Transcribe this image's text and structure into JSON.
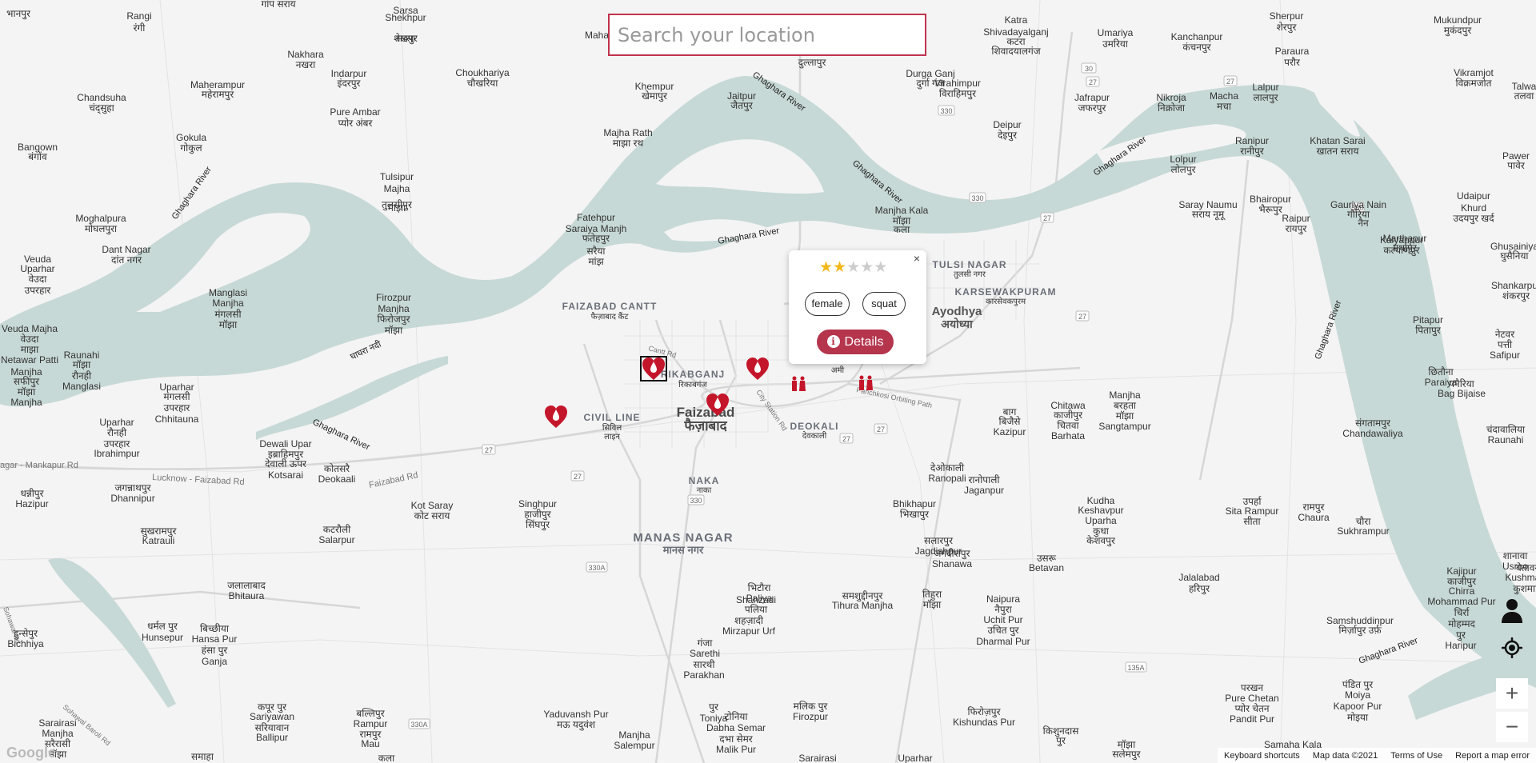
{
  "search": {
    "placeholder": "Search your location",
    "value": ""
  },
  "popup": {
    "rating": 2,
    "max_rating": 5,
    "stars": [
      "★",
      "★",
      "★",
      "★",
      "★"
    ],
    "tags": [
      "female",
      "squat"
    ],
    "details_label": "Details",
    "close_label": "×",
    "info_glyph": "i"
  },
  "places": [
    {
      "t": "भानपुर"
    },
    {
      "t": "Rangi"
    },
    {
      "t": "रंगी"
    },
    {
      "t": "गांप सराय"
    },
    {
      "t": "Sarsa"
    },
    {
      "t": "Shekhpur"
    },
    {
      "t": "सरसा"
    },
    {
      "t": "शेखपुर"
    },
    {
      "t": "Maha"
    },
    {
      "t": "दुल्लापुर"
    },
    {
      "t": "Katra"
    },
    {
      "t": "Shivadayalganj"
    },
    {
      "t": "कटरा"
    },
    {
      "t": "शिवादयालगंज"
    },
    {
      "t": "Umariya"
    },
    {
      "t": "उमरिया"
    },
    {
      "t": "Kanchanpur"
    },
    {
      "t": "कंचनपुर"
    },
    {
      "t": "Sherpur"
    },
    {
      "t": "शेरपुर"
    },
    {
      "t": "Mukundpur"
    },
    {
      "t": "मुकंदपुर"
    },
    {
      "t": "Nakhara"
    },
    {
      "t": "नखरा"
    },
    {
      "t": "Paraura"
    },
    {
      "t": "परौर"
    },
    {
      "t": "Maherampur"
    },
    {
      "t": "महेरामपुर"
    },
    {
      "t": "Indarpur"
    },
    {
      "t": "इंदरपुर"
    },
    {
      "t": "Choukhariya"
    },
    {
      "t": "चौखरिया"
    },
    {
      "t": "Khempur"
    },
    {
      "t": "खेमापुर"
    },
    {
      "t": "Jaitpur"
    },
    {
      "t": "जैतपुर"
    },
    {
      "t": "Durga Ganj"
    },
    {
      "t": "दुर्गा गंज"
    },
    {
      "t": "Virahimpur"
    },
    {
      "t": "विराहिमपुर"
    },
    {
      "t": "Jafrapur"
    },
    {
      "t": "जफरपुर"
    },
    {
      "t": "Nikroja"
    },
    {
      "t": "निक्रोजा"
    },
    {
      "t": "Macha"
    },
    {
      "t": "मचा"
    },
    {
      "t": "Lalpur"
    },
    {
      "t": "लालपुर"
    },
    {
      "t": "Vikramjot"
    },
    {
      "t": "विक्रमजोत"
    },
    {
      "t": "Talwa"
    },
    {
      "t": "तलवा"
    },
    {
      "t": "Chandsuha"
    },
    {
      "t": "चंद्सुहा"
    },
    {
      "t": "Pure Ambar"
    },
    {
      "t": "प्योर अंबर"
    },
    {
      "t": "Gokula"
    },
    {
      "t": "गोकुल"
    },
    {
      "t": "Majha Rath"
    },
    {
      "t": "माझा रथ"
    },
    {
      "t": "Deipur"
    },
    {
      "t": "देइपुर"
    },
    {
      "t": "Ranipur"
    },
    {
      "t": "रानीपुर"
    },
    {
      "t": "Khatan Sarai"
    },
    {
      "t": "खातन सराय"
    },
    {
      "t": "Pawer"
    },
    {
      "t": "पावेर"
    },
    {
      "t": "Bangown"
    },
    {
      "t": "बंगोंव"
    },
    {
      "t": "Lolpur"
    },
    {
      "t": "लोलपुर"
    },
    {
      "t": "Tulsipur"
    },
    {
      "t": "Majha"
    },
    {
      "t": "तुलसीपुर"
    },
    {
      "t": "माझा"
    },
    {
      "t": "Bhairopur"
    },
    {
      "t": "भैरूपुर"
    },
    {
      "t": "Gauriya Nain"
    },
    {
      "t": "गौरिया"
    },
    {
      "t": "नैन"
    },
    {
      "t": "Udaipur"
    },
    {
      "t": "Khurd"
    },
    {
      "t": "उदयपुर खर्द"
    },
    {
      "t": "Saray Naumu"
    },
    {
      "t": "सराय नूमू"
    },
    {
      "t": "Moghalpura"
    },
    {
      "t": "मोघलपुरा"
    },
    {
      "t": "Fatehpur"
    },
    {
      "t": "Saraiya Manjh"
    },
    {
      "t": "फतेहपुर"
    },
    {
      "t": "सरैया"
    },
    {
      "t": "मांझ"
    },
    {
      "t": "Manjha Kala"
    },
    {
      "t": "मॉझा"
    },
    {
      "t": "कला"
    },
    {
      "t": "Raipur"
    },
    {
      "t": "रायपुर"
    },
    {
      "t": "Marthapur"
    },
    {
      "t": "मर्थापुर"
    },
    {
      "t": "Dant Nagar"
    },
    {
      "t": "दांत नगर"
    },
    {
      "t": "Ghusainiya"
    },
    {
      "t": "घुसैनिया"
    },
    {
      "t": "Veuda"
    },
    {
      "t": "Uparhar"
    },
    {
      "t": "वेउदा"
    },
    {
      "t": "उपरहार"
    },
    {
      "t": "Kalyanpur"
    },
    {
      "t": "कल्याणपुर"
    },
    {
      "t": "Shankarpur"
    },
    {
      "t": "शंकरपुर"
    },
    {
      "t": "Manglasi"
    },
    {
      "t": "Manjha"
    },
    {
      "t": "मंगलसी"
    },
    {
      "t": "मॉझा"
    },
    {
      "t": "Firozpur"
    },
    {
      "t": "Manjha"
    },
    {
      "t": "फिरोजपुर"
    },
    {
      "t": "मॉझा"
    },
    {
      "t": "Pitapur"
    },
    {
      "t": "पितापुर"
    },
    {
      "t": "Veuda Majha"
    },
    {
      "t": "वेउदा"
    },
    {
      "t": "माझा"
    },
    {
      "t": "Netawar Patti"
    },
    {
      "t": "नेटवर"
    },
    {
      "t": "पत्ती"
    },
    {
      "t": "Safipur"
    },
    {
      "t": "Manjha"
    },
    {
      "t": "सफीपुर"
    },
    {
      "t": "मॉझा"
    },
    {
      "t": "Manjha"
    },
    {
      "t": "Raunahi"
    },
    {
      "t": "मॉझा"
    },
    {
      "t": "रौनही"
    },
    {
      "t": "Manglasi"
    },
    {
      "t": "Uparhar"
    },
    {
      "t": "मंगलसी"
    },
    {
      "t": "उपरहार"
    },
    {
      "t": "Chhitauna"
    },
    {
      "t": "छितौना"
    },
    {
      "t": "Paraiya"
    },
    {
      "t": "पनैरिया"
    },
    {
      "t": "Bag Bijaise"
    },
    {
      "t": "बाग"
    },
    {
      "t": "बिजैसे"
    },
    {
      "t": "Kazipur"
    },
    {
      "t": "Chitawa"
    },
    {
      "t": "काजीपुर"
    },
    {
      "t": "चितवा"
    },
    {
      "t": "Barhata"
    },
    {
      "t": "Manjha"
    },
    {
      "t": "बरहता"
    },
    {
      "t": "मॉझा"
    },
    {
      "t": "Sangtampur"
    },
    {
      "t": "संगतामपुर"
    },
    {
      "t": "Chandawaliya"
    },
    {
      "t": "चंदावालिया"
    },
    {
      "t": "Raunahi"
    },
    {
      "t": "Uparhar"
    },
    {
      "t": "रौनही"
    },
    {
      "t": "उपरहार"
    },
    {
      "t": "Ibrahimpur"
    },
    {
      "t": "Dewali Upar"
    },
    {
      "t": "इब्राहिमपुर"
    },
    {
      "t": "देवाली ऊपर"
    },
    {
      "t": "Kotsarai"
    },
    {
      "t": "कोतसरै"
    },
    {
      "t": "Deokaali"
    },
    {
      "t": "देओकाली"
    },
    {
      "t": "Ranopali"
    },
    {
      "t": "रानोपाली"
    },
    {
      "t": "Jaganpur"
    },
    {
      "t": "जगन्नाथपुर"
    },
    {
      "t": "Dhannipur"
    },
    {
      "t": "धन्नीपुर"
    },
    {
      "t": "Hazipur"
    },
    {
      "t": "Singhpur"
    },
    {
      "t": "हाजीपुर"
    },
    {
      "t": "सिंघपुर"
    },
    {
      "t": "Kot Saray"
    },
    {
      "t": "कोट सराय"
    },
    {
      "t": "Bhikhapur"
    },
    {
      "t": "भिखापुर"
    },
    {
      "t": "Kudha"
    },
    {
      "t": "Keshavpur"
    },
    {
      "t": "Uparha"
    },
    {
      "t": "कुधा"
    },
    {
      "t": "केशवपुर"
    },
    {
      "t": "उपर्हा"
    },
    {
      "t": "Sita Rampur"
    },
    {
      "t": "सीता"
    },
    {
      "t": "रामपुर"
    },
    {
      "t": "Chaura"
    },
    {
      "t": "चौरा"
    },
    {
      "t": "Sukhrampur"
    },
    {
      "t": "सुखरामपुर"
    },
    {
      "t": "Katrauli"
    },
    {
      "t": "कटरौली"
    },
    {
      "t": "Salarpur"
    },
    {
      "t": "सलारपुर"
    },
    {
      "t": "Jagdishpur"
    },
    {
      "t": "जगदीशपुर"
    },
    {
      "t": "Shanawa"
    },
    {
      "t": "शानावा"
    },
    {
      "t": "Usroo"
    },
    {
      "t": "उसरू"
    },
    {
      "t": "Betavan"
    },
    {
      "t": "बेतावन"
    },
    {
      "t": "Kushmaha"
    },
    {
      "t": "कुशमाहा"
    },
    {
      "t": "Kajipur"
    },
    {
      "t": "काजीपुर"
    },
    {
      "t": "Chirra"
    },
    {
      "t": "Mohammad Pur"
    },
    {
      "t": "चिर्रा"
    },
    {
      "t": "मोहम्मद"
    },
    {
      "t": "पुर"
    },
    {
      "t": "Haripur"
    },
    {
      "t": "Jalalabad"
    },
    {
      "t": "हरिपुर"
    },
    {
      "t": "जलालाबाद"
    },
    {
      "t": "Bhitaura"
    },
    {
      "t": "भिटौरा"
    },
    {
      "t": "Paliya"
    },
    {
      "t": "Shahzadi"
    },
    {
      "t": "पलिया"
    },
    {
      "t": "शहज़ादी"
    },
    {
      "t": "Mirzapur Urf"
    },
    {
      "t": "Samshuddinpur"
    },
    {
      "t": "मिर्ज़ापुर उर्फ़"
    },
    {
      "t": "समशुद्दीनपुर"
    },
    {
      "t": "Tihura Manjha"
    },
    {
      "t": "तिहुरा"
    },
    {
      "t": "मॉझा"
    },
    {
      "t": "Naipura"
    },
    {
      "t": "नैपुरा"
    },
    {
      "t": "Uchit Pur"
    },
    {
      "t": "उचित पुर"
    },
    {
      "t": "Dharmal Pur"
    },
    {
      "t": "धर्मल पुर"
    },
    {
      "t": "Hunsepur"
    },
    {
      "t": "हुन्सेपुर"
    },
    {
      "t": "Bichhiya"
    },
    {
      "t": "बिच्छीया"
    },
    {
      "t": "Hansa Pur"
    },
    {
      "t": "हंसा पुर"
    },
    {
      "t": "Ganja"
    },
    {
      "t": "गंजा"
    },
    {
      "t": "Sarethi"
    },
    {
      "t": "सारथी"
    },
    {
      "t": "Parakhan"
    },
    {
      "t": "परखन"
    },
    {
      "t": "Pure Chetan"
    },
    {
      "t": "प्योर चेतन"
    },
    {
      "t": "Pandit Pur"
    },
    {
      "t": "पंडित पुर"
    },
    {
      "t": "Moiya"
    },
    {
      "t": "Kapoor Pur"
    },
    {
      "t": "मोइया"
    },
    {
      "t": "कपूर पुर"
    },
    {
      "t": "Sariyawan"
    },
    {
      "t": "सरियावान"
    },
    {
      "t": "Ballipur"
    },
    {
      "t": "बल्लिपुर"
    },
    {
      "t": "Rampur"
    },
    {
      "t": "रामपुर"
    },
    {
      "t": "Mau"
    },
    {
      "t": "Yaduvansh Pur"
    },
    {
      "t": "मऊ यदुवंश"
    },
    {
      "t": "पुर"
    },
    {
      "t": "Toniya"
    },
    {
      "t": "टोनिया"
    },
    {
      "t": "Dabha Semar"
    },
    {
      "t": "दभा सेमर"
    },
    {
      "t": "Malik Pur"
    },
    {
      "t": "मलिक पुर"
    },
    {
      "t": "Firozpur"
    },
    {
      "t": "फिरोज़पुर"
    },
    {
      "t": "Kishundas Pur"
    },
    {
      "t": "किशुनदास"
    },
    {
      "t": "पुर"
    },
    {
      "t": "Sarairasi"
    },
    {
      "t": "Manjha"
    },
    {
      "t": "सरैरासी"
    },
    {
      "t": "मॉझा"
    },
    {
      "t": "Manjha"
    },
    {
      "t": "Salempur"
    },
    {
      "t": "मॉझा"
    },
    {
      "t": "सलेमपुर"
    },
    {
      "t": "Samaha Kala"
    },
    {
      "t": "समाहा"
    },
    {
      "t": "कला"
    },
    {
      "t": "Sarairasi"
    },
    {
      "t": "Uparhar"
    },
    {
      "t": "सरैरासी"
    },
    {
      "t": "उपरहार"
    },
    {
      "t": "Manjhapure"
    },
    {
      "t": "Chetan"
    },
    {
      "t": "मंझापुरे"
    },
    {
      "t": "चेतन"
    },
    {
      "t": "Sirhirnar"
    },
    {
      "t": "Singhpur"
    },
    {
      "t": "सिर्हिनर"
    },
    {
      "t": "सिंघपुर"
    },
    {
      "t": "Gauhaniya"
    },
    {
      "t": "Saloni"
    },
    {
      "t": "गौहानिया"
    },
    {
      "t": "सलोनी"
    },
    {
      "t": "Kurawan"
    },
    {
      "t": "कुरवान"
    },
    {
      "t": "Ragghoopur"
    },
    {
      "t": "रागघूपुर"
    },
    {
      "t": "Khanpur"
    },
    {
      "t": "Masodha"
    },
    {
      "t": "खानपुर"
    },
    {
      "t": "मसोधा"
    },
    {
      "t": "Bhadokhar"
    },
    {
      "t": "भादोखार"
    },
    {
      "t": "Dadera"
    },
    {
      "t": "दादेरा"
    },
    {
      "t": "Bahoran Pur"
    },
    {
      "t": "बाहोरन पुर"
    },
    {
      "t": "Gaura"
    },
    {
      "t": "Brahman"
    },
    {
      "t": "गौरा"
    },
    {
      "t": "ब्राह्मण"
    },
    {
      "t": "Mahawan"
    },
    {
      "t": "महावान"
    },
    {
      "t": "Baisingh"
    },
    {
      "t": "बैसिंघ"
    },
    {
      "t": "Rajepur"
    },
    {
      "t": "Mohjuddin Pur"
    },
    {
      "t": "Sathri"
    },
    {
      "t": "Birauli"
    },
    {
      "t": "Uchar Pur"
    }
  ],
  "major_places": {
    "faizabad_cantt": "FAIZABAD CANTT",
    "faizabad_cantt_hi": "फैज़ाबाद कैंट",
    "rikabganj": "RIKABGANJ",
    "rikabganj_hi": "रिकाबगंज",
    "civil_line": "CIVIL LINE",
    "civil_line_hi": "सिविल",
    "civil_line_hi2": "लाइन",
    "faizabad": "Faizabad",
    "faizabad_hi": "फैज़ाबाद",
    "deokali": "DEOKALI",
    "deokali_hi": "देवकाली",
    "naka": "NAKA",
    "naka_hi": "नाका",
    "manas_nagar": "MANAS NAGAR",
    "manas_nagar_hi": "मानस नगर",
    "ayodhya": "Ayodhya",
    "ayodhya_hi": "अयोध्या",
    "tulsi_nagar": "TULSI NAGAR",
    "tulsi_nagar_hi": "तुलसी नगर",
    "karsewakpuram": "KARSEWAKPURAM",
    "karsewakpuram_hi": "कारसेवकपुरम",
    "ami": "अमी"
  },
  "rivers": {
    "ghaghara": "Ghaghara River",
    "ghaghra_hindi": "घाघरा नदी"
  },
  "roads": {
    "lucknow_faizabad": "Lucknow - Faizabad Rd",
    "nagar_mankapur": "agar - Mankapur Rd",
    "faizabad_rd": "Faizabad Rd",
    "cantt_rd": "Cantt Rd",
    "city_station_rd": "City Station Rd",
    "panchkosi": "Panchkosi Orbiting Path",
    "sohawal_baroli": "Sohawal Baroli Rd",
    "rd_left": "Sohawal Rd"
  },
  "shields": [
    "27",
    "27",
    "27",
    "27",
    "27",
    "27",
    "27",
    "27",
    "330",
    "330",
    "330",
    "330",
    "330A",
    "330A",
    "135A",
    "30"
  ],
  "footer": {
    "shortcuts": "Keyboard shortcuts",
    "mapdata": "Map data ©2021",
    "terms": "Terms of Use",
    "report": "Report a map error",
    "logo": "Google"
  },
  "controls": {
    "zoom_in": "+",
    "zoom_out": "−"
  },
  "colors": {
    "water": "#c7d9d6",
    "accent": "#b5354d",
    "marker": "#c4162a",
    "star_on": "#f2b81c"
  },
  "icons": {
    "marker": "blood-drop-heart-icon",
    "toilet": "toilet-icon",
    "user": "person-icon",
    "locate": "my-location-icon"
  }
}
